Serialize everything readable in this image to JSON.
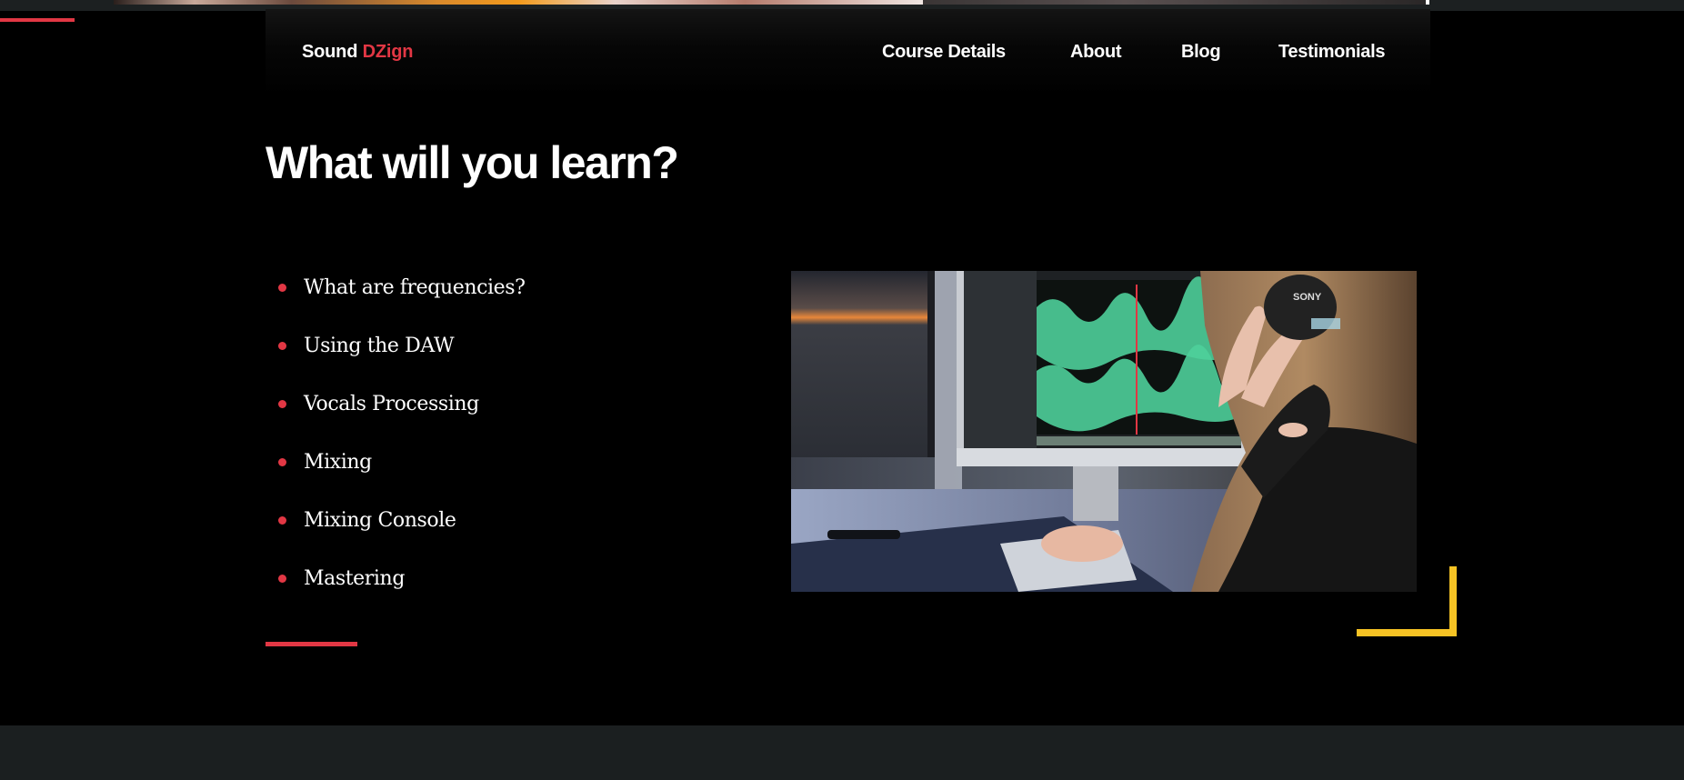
{
  "header": {
    "brand_part1": "Sound",
    "brand_part2": "DZign",
    "nav": {
      "course_details": "Course Details",
      "about": "About",
      "blog": "Blog",
      "testimonials": "Testimonials"
    }
  },
  "section": {
    "title": "What will you learn?",
    "items": [
      "What are frequencies?",
      "Using the DAW",
      "Vocals Processing",
      "Mixing",
      "Mixing Console",
      "Mastering"
    ]
  },
  "image": {
    "headphone_brand": "SONY"
  },
  "colors": {
    "accent_red": "#e23744",
    "accent_yellow": "#f6c324",
    "background": "#000000",
    "footer": "#1b1f20"
  }
}
